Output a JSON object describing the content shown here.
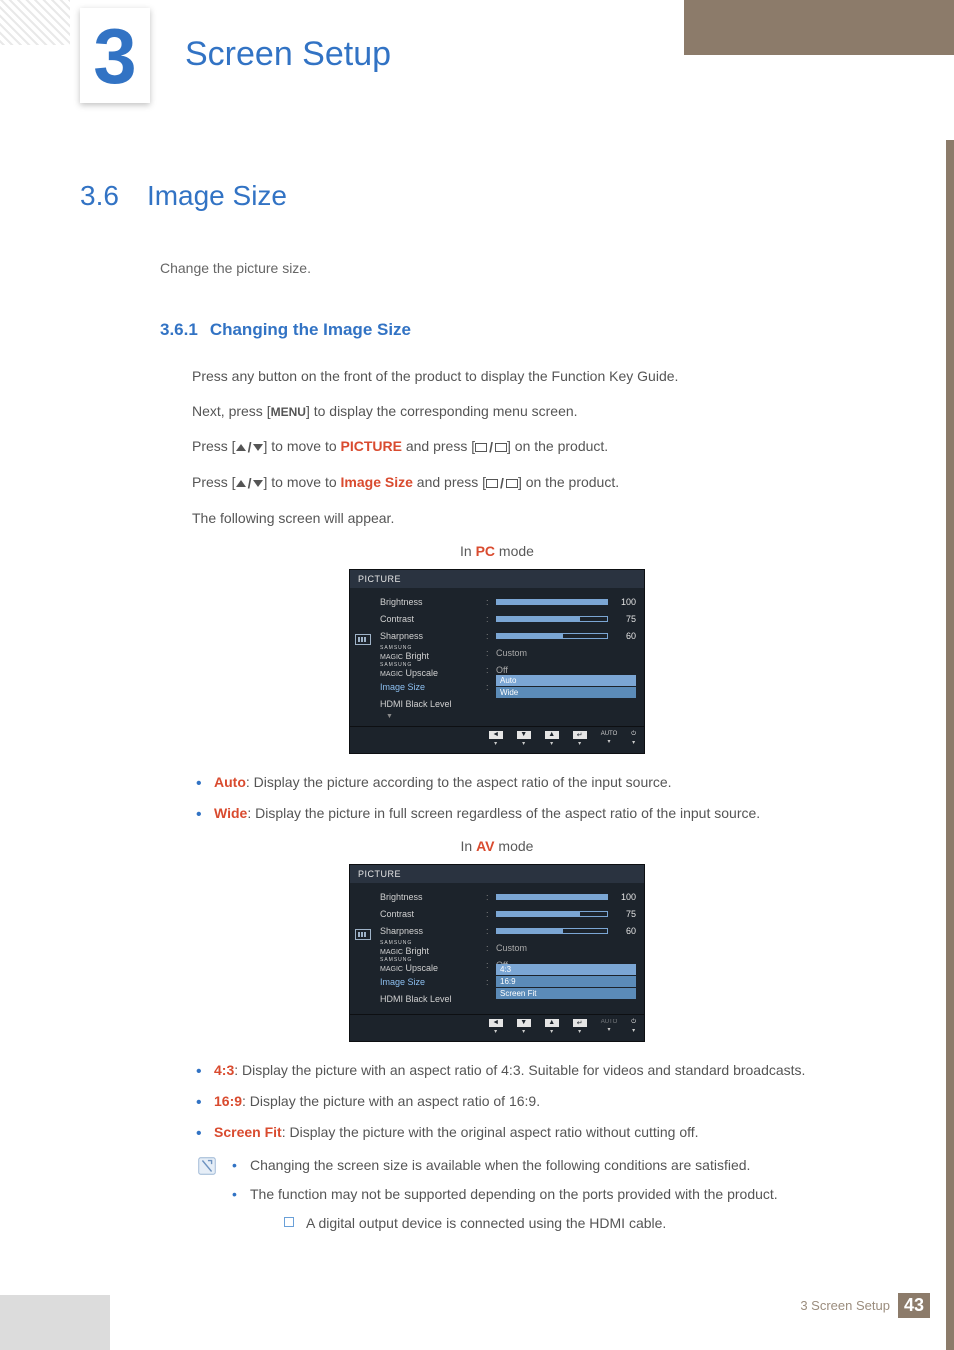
{
  "chapter": {
    "number": "3",
    "title": "Screen Setup"
  },
  "section": {
    "number": "3.6",
    "title": "Image Size",
    "intro": "Change the picture size."
  },
  "subsection": {
    "number": "3.6.1",
    "title": "Changing the Image Size"
  },
  "steps": {
    "s1": "Press any button on the front of the product to display the Function Key Guide.",
    "s2a": "Next, press [",
    "s2_menu": "MENU",
    "s2b": "] to display the corresponding menu screen.",
    "s3a": "Press [",
    "s3b": "] to move to ",
    "s3_picture": "PICTURE",
    "s3c": " and press [",
    "s3d": "] on the product.",
    "s4a": "Press [",
    "s4b": "] to move to ",
    "s4_is": "Image Size",
    "s4c": " and press [",
    "s4d": "] on the product.",
    "s5": "The following screen will appear."
  },
  "caption_pc_a": "In ",
  "caption_pc_b": "PC",
  "caption_pc_c": " mode",
  "caption_av_a": "In ",
  "caption_av_b": "AV",
  "caption_av_c": " mode",
  "osd": {
    "title": "PICTURE",
    "brightness": "Brightness",
    "contrast": "Contrast",
    "sharpness": "Sharpness",
    "magic_bright": "Bright",
    "magic_upscale": "Upscale",
    "image_size": "Image Size",
    "hdmi": "HDMI Black Level",
    "custom": "Custom",
    "off": "Off",
    "v100": "100",
    "v75": "75",
    "v60": "60",
    "pc_opts": {
      "auto": "Auto",
      "wide": "Wide"
    },
    "av_opts": {
      "r43": "4:3",
      "r169": "16:9",
      "fit": "Screen Fit"
    },
    "footer_auto": "AUTO",
    "samsung": "SAMSUNG",
    "magic": "MAGIC"
  },
  "pc_bullets": {
    "auto_t": "Auto",
    "auto_d": ": Display the picture according to the aspect ratio of the input source.",
    "wide_t": "Wide",
    "wide_d": ": Display the picture in full screen regardless of the aspect ratio of the input source."
  },
  "av_bullets": {
    "r43_t": "4:3",
    "r43_d": ": Display the picture with an aspect ratio of 4:3. Suitable for videos and standard broadcasts.",
    "r169_t": "16:9",
    "r169_d": ": Display the picture with an aspect ratio of 16:9.",
    "fit_t": "Screen Fit",
    "fit_d": ": Display the picture with the original aspect ratio without cutting off."
  },
  "notes": {
    "n1": "Changing the screen size is available when the following conditions are satisfied.",
    "n2": "The function may not be supported depending on the ports provided with the product.",
    "n2a": "A digital output device is connected using the HDMI cable."
  },
  "footer": {
    "text": "3 Screen Setup",
    "page": "43"
  }
}
